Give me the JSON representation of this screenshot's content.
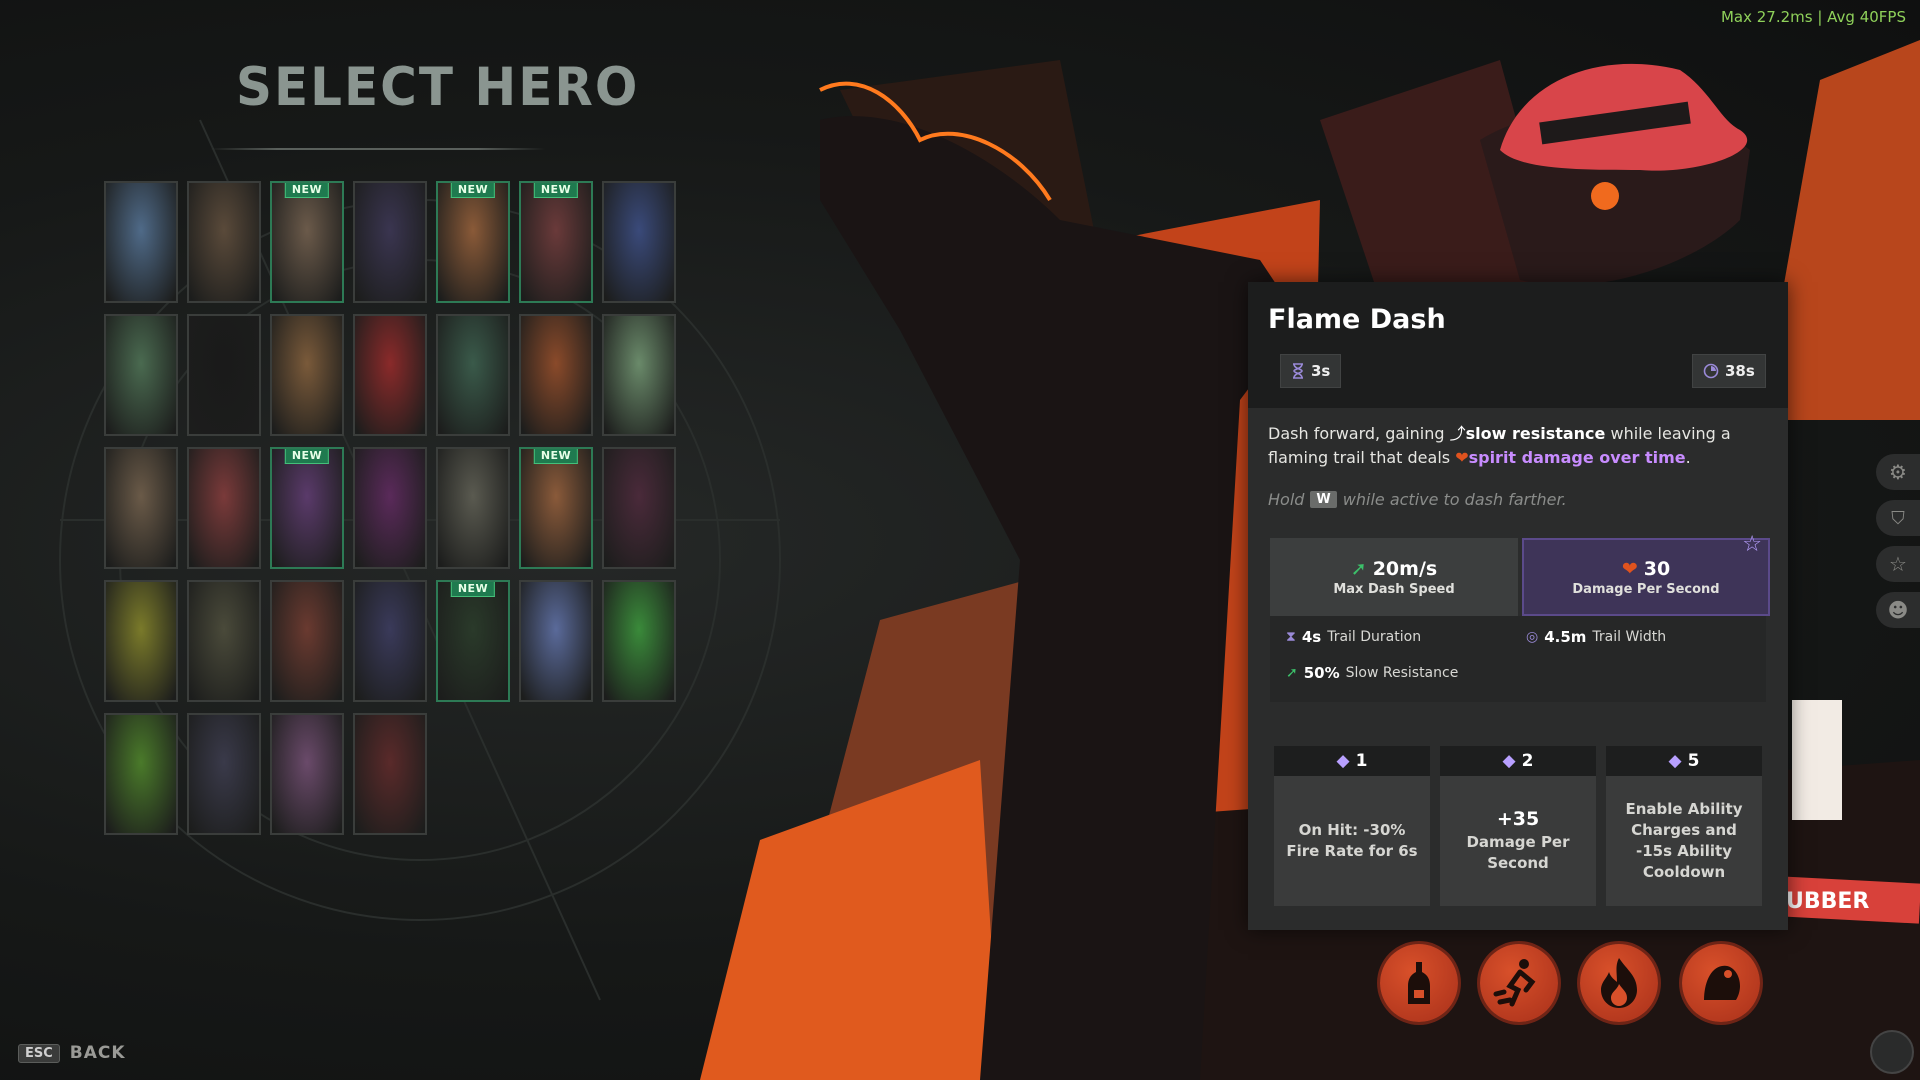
{
  "fps_overlay": "Max  27.2ms | Avg  40FPS",
  "screen_title": "SELECT HERO",
  "back": {
    "key": "ESC",
    "label": "BACK"
  },
  "hero_grid": {
    "new_badge": "NEW",
    "rows": [
      [
        {
          "new": false,
          "color": "#4f6a88"
        },
        {
          "new": false,
          "color": "#5a4a3a"
        },
        {
          "new": true,
          "color": "#6b5a4a"
        },
        {
          "new": false,
          "color": "#3a3550"
        },
        {
          "new": true,
          "color": "#8a5a38"
        },
        {
          "new": true,
          "color": "#6a3a3a"
        },
        {
          "new": false,
          "color": "#3a4a7a"
        }
      ],
      [
        {
          "new": false,
          "color": "#4a6a50"
        },
        {
          "new": false,
          "color": "#1a1a1a"
        },
        {
          "new": false,
          "color": "#7a5a3a"
        },
        {
          "new": false,
          "color": "#8a2a2a"
        },
        {
          "new": false,
          "color": "#3a5a4a"
        },
        {
          "new": false,
          "color": "#8a4a2a"
        },
        {
          "new": false,
          "color": "#6a8a6a"
        }
      ],
      [
        {
          "new": false,
          "color": "#6a5a48"
        },
        {
          "new": false,
          "color": "#7a3a3a"
        },
        {
          "new": true,
          "color": "#5a3a6a"
        },
        {
          "new": false,
          "color": "#5a2a5a"
        },
        {
          "new": false,
          "color": "#5a5a50"
        },
        {
          "new": true,
          "color": "#8a5a3a"
        },
        {
          "new": false,
          "color": "#4a2a3a"
        }
      ],
      [
        {
          "new": false,
          "color": "#7a7a2a"
        },
        {
          "new": false,
          "color": "#4a4a3a"
        },
        {
          "new": false,
          "color": "#6a3a30"
        },
        {
          "new": false,
          "color": "#3a3a5a"
        },
        {
          "new": true,
          "color": "#2a3a2a"
        },
        {
          "new": false,
          "color": "#5a6a9a"
        },
        {
          "new": false,
          "color": "#3a8a3a"
        }
      ],
      [
        {
          "new": false,
          "color": "#4a7a2a"
        },
        {
          "new": false,
          "color": "#3a3a4a"
        },
        {
          "new": false,
          "color": "#6a4a6a"
        },
        {
          "new": false,
          "color": "#5a2a2a"
        }
      ]
    ]
  },
  "ability": {
    "name": "Flame Dash",
    "cast_time": "3s",
    "cooldown": "38s",
    "description_parts": [
      "Dash forward, gaining ",
      "slow resistance",
      " while leaving a flaming trail that deals ",
      "spirit damage over time",
      "."
    ],
    "hint_before": "Hold",
    "hint_key": "W",
    "hint_after": "while active to dash farther.",
    "stats": [
      {
        "value": "20m/s",
        "label": "Max Dash Speed"
      },
      {
        "value": "30",
        "label": "Damage Per Second"
      }
    ],
    "props": [
      {
        "value": "4s",
        "label": "Trail Duration"
      },
      {
        "value": "4.5m",
        "label": "Trail Width"
      },
      {
        "value": "50%",
        "label": "Slow Resistance"
      }
    ],
    "upgrades": [
      {
        "cost": "1",
        "big": "",
        "text": "On Hit: -30% Fire Rate for 6s"
      },
      {
        "cost": "2",
        "big": "+35",
        "text": "Damage Per Second"
      },
      {
        "cost": "5",
        "big": "",
        "text": "Enable Ability Charges and -15s Ability Cooldown"
      }
    ]
  },
  "ability_icons": [
    "molotov-icon",
    "flame-dash-icon",
    "fire-icon",
    "heavy-hitter-icon"
  ],
  "hero_banner_fragment": "UBBER",
  "colors": {
    "accent_orange": "#e0531e",
    "new_green": "#1f7a4f",
    "spirit_purple": "#c88cff"
  }
}
